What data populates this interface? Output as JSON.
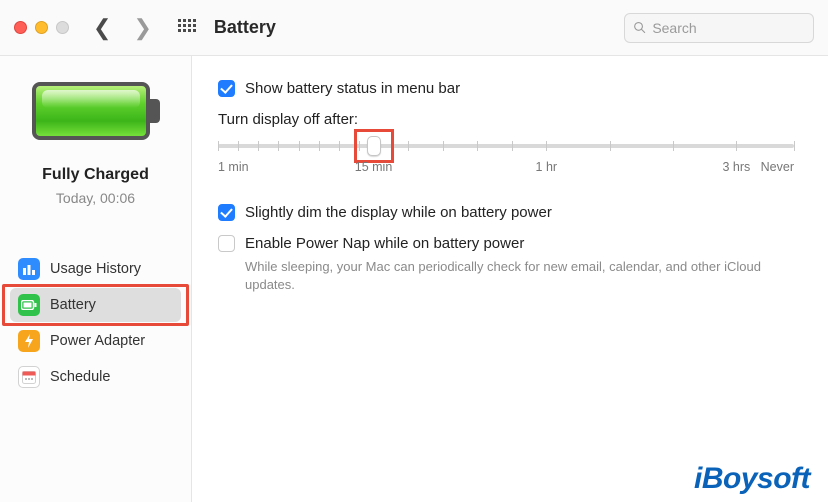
{
  "window": {
    "title": "Battery"
  },
  "search": {
    "placeholder": "Search",
    "value": ""
  },
  "sidebar": {
    "status_title": "Fully Charged",
    "status_sub": "Today, 00:06",
    "items": [
      {
        "label": "Usage History"
      },
      {
        "label": "Battery"
      },
      {
        "label": "Power Adapter"
      },
      {
        "label": "Schedule"
      }
    ],
    "selected_index": 1
  },
  "settings": {
    "show_in_menubar": {
      "checked": true,
      "label": "Show battery status in menu bar"
    },
    "turn_off_title": "Turn display off after:",
    "slider": {
      "labels": [
        "1 min",
        "15 min",
        "1 hr",
        "3 hrs",
        "Never"
      ],
      "label_positions_pct": [
        0,
        27,
        57,
        90,
        100
      ],
      "tick_positions_pct": [
        0,
        3.5,
        7,
        10.5,
        14,
        17.5,
        21,
        24.5,
        27,
        33,
        39,
        45,
        51,
        57,
        68,
        79,
        90,
        100
      ],
      "handle_pct": 27
    },
    "dim_display": {
      "checked": true,
      "label": "Slightly dim the display while on battery power"
    },
    "power_nap": {
      "checked": false,
      "label": "Enable Power Nap while on battery power",
      "note": "While sleeping, your Mac can periodically check for new email, calendar, and other iCloud updates."
    }
  },
  "watermark": "iBoysoft"
}
